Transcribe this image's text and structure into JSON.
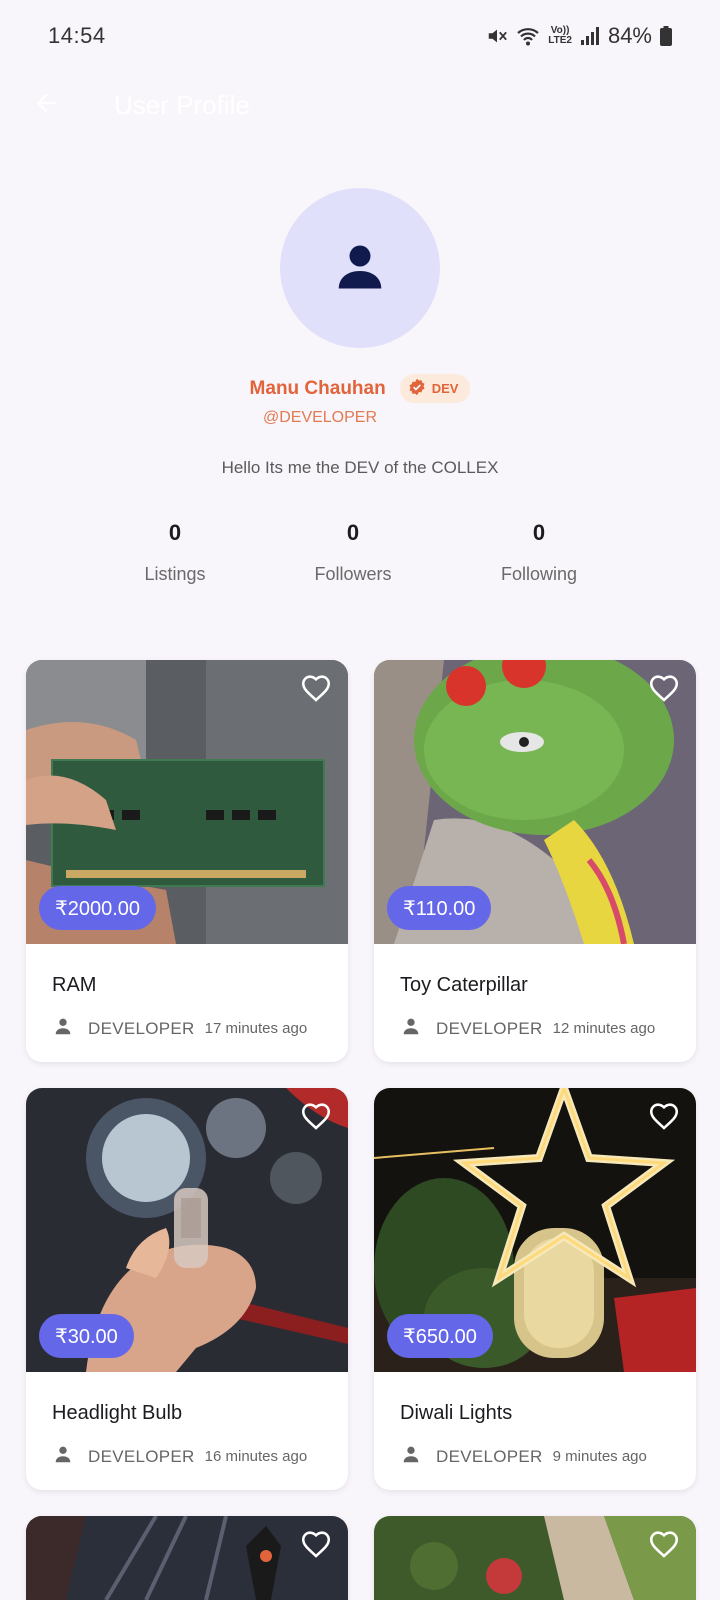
{
  "status_bar": {
    "time": "14:54",
    "network": "LTE2",
    "network_top": "Vo))",
    "battery": "84%"
  },
  "app_bar": {
    "title": "User Profile"
  },
  "profile": {
    "name": "Manu Chauhan",
    "badge": "DEV",
    "username": "@DEVELOPER",
    "bio": "Hello Its me the DEV of the COLLEX",
    "stats": [
      {
        "value": "0",
        "label": "Listings"
      },
      {
        "value": "0",
        "label": "Followers"
      },
      {
        "value": "0",
        "label": "Following"
      }
    ]
  },
  "listings": [
    {
      "title": "RAM",
      "price": "₹2000.00",
      "seller": "DEVELOPER",
      "time": "17 minutes ago"
    },
    {
      "title": "Toy Caterpillar",
      "price": "₹110.00",
      "seller": "DEVELOPER",
      "time": "12 minutes ago"
    },
    {
      "title": "Headlight Bulb",
      "price": "₹30.00",
      "seller": "DEVELOPER",
      "time": "16 minutes ago"
    },
    {
      "title": "Diwali Lights",
      "price": "₹650.00",
      "seller": "DEVELOPER",
      "time": "9 minutes ago"
    }
  ],
  "colors": {
    "accent": "#6467e8",
    "name": "#e2643a",
    "avatar_bg": "#e1e0fb",
    "background": "#f8f5fb"
  },
  "icons": {
    "back": "arrow-left-icon",
    "favorite": "heart-outline-icon",
    "seller": "person-icon",
    "avatar": "person-icon",
    "badge": "verified-icon"
  }
}
